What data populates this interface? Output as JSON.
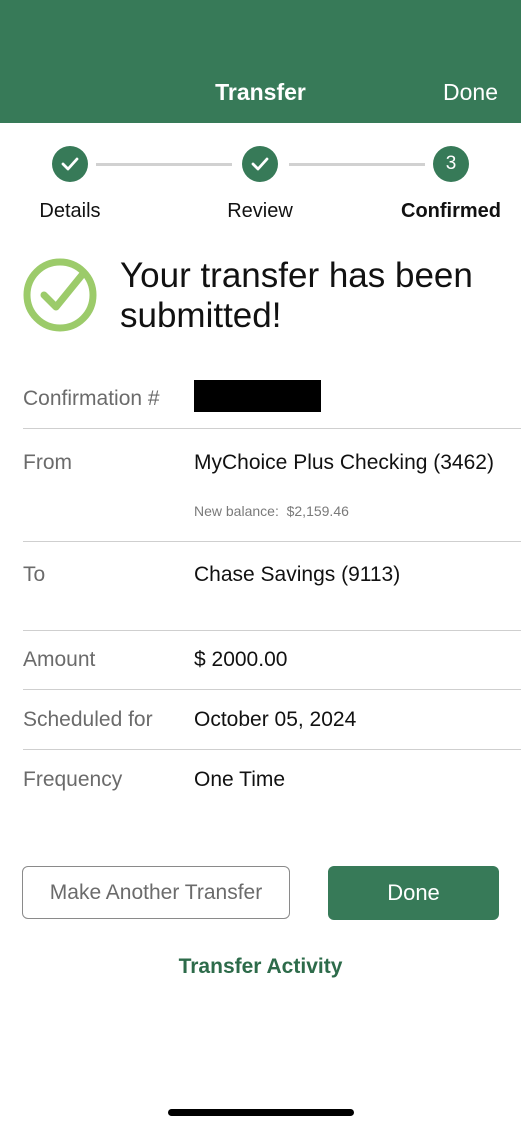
{
  "header": {
    "title": "Transfer",
    "done_label": "Done"
  },
  "steps": [
    {
      "label": "Details",
      "state": "complete",
      "icon": "check-icon"
    },
    {
      "label": "Review",
      "state": "complete",
      "icon": "check-icon"
    },
    {
      "label": "Confirmed",
      "state": "current",
      "number": "3"
    }
  ],
  "success": {
    "message": "Your transfer has been submitted!",
    "icon": "success-check-icon"
  },
  "details": {
    "confirmation_label": "Confirmation #",
    "from_label": "From",
    "from_value": "MyChoice Plus Checking (3462)",
    "new_balance_label": "New balance:",
    "new_balance_value": "$2,159.46",
    "to_label": "To",
    "to_value": "Chase Savings (9113)",
    "amount_label": "Amount",
    "amount_value": "$ 2000.00",
    "scheduled_label": "Scheduled for",
    "scheduled_value": "October 05, 2024",
    "frequency_label": "Frequency",
    "frequency_value": "One Time"
  },
  "actions": {
    "make_another_label": "Make Another Transfer",
    "done_label": "Done",
    "activity_link": "Transfer Activity"
  },
  "colors": {
    "brand_green": "#377a58",
    "success_green": "#9ccb6a"
  }
}
